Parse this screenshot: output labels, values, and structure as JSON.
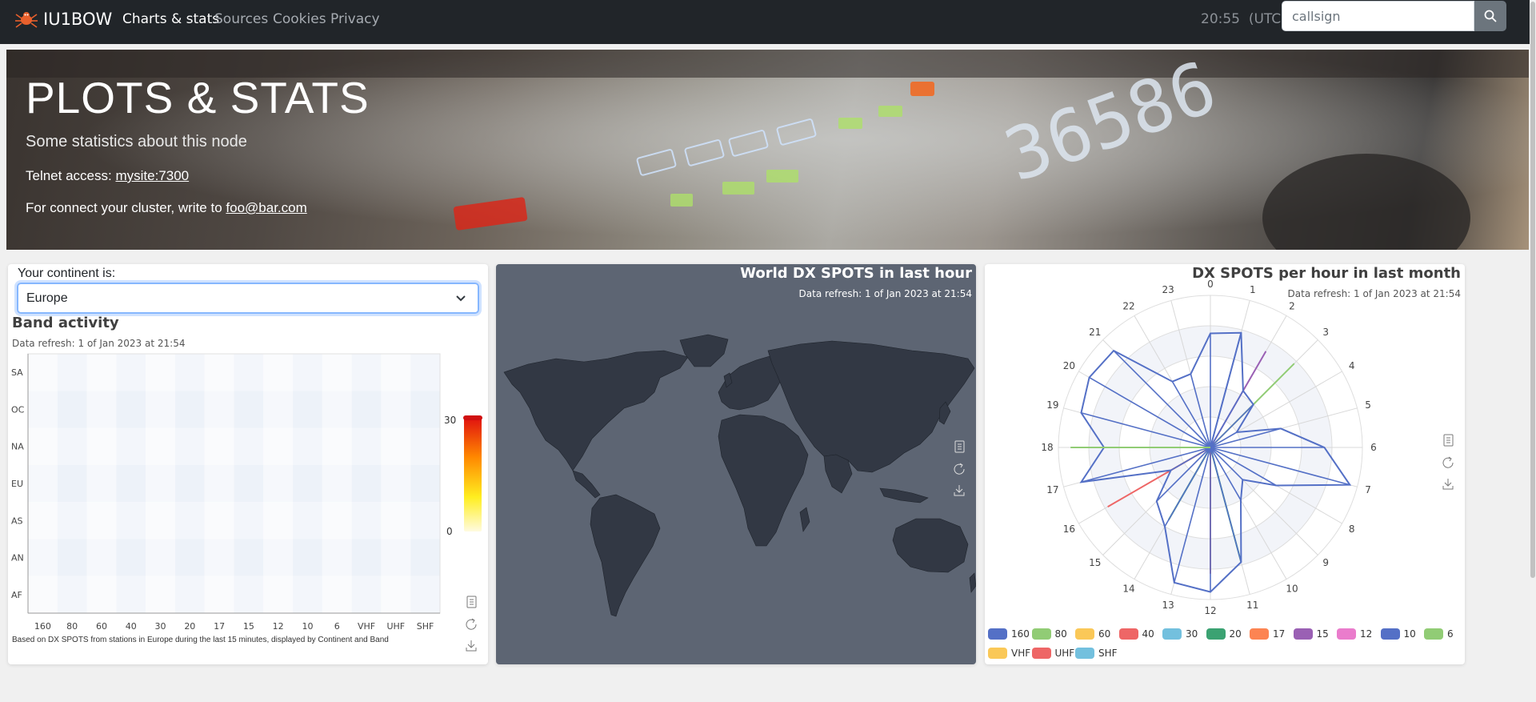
{
  "navbar": {
    "brand": "IU1BOW",
    "links": [
      "Charts & stats",
      "Sources",
      "Cookies",
      "Privacy"
    ],
    "clock": "20:55",
    "clock_tz": "(UTC)",
    "search_placeholder": "callsign"
  },
  "hero": {
    "title": "PLOTS & STATS",
    "subtitle": "Some statistics about this node",
    "telnet_label": "Telnet access:",
    "telnet_link": "mysite:7300",
    "connect_label": "For connect your cluster, write to",
    "connect_link": "foo@bar.com"
  },
  "band_activity": {
    "continent_label": "Your continent is:",
    "continent_value": "Europe",
    "title": "Band activity",
    "refresh": "Data refresh: 1 of Jan 2023 at 21:54",
    "footnote": "Based on DX SPOTS from stations in Europe during the last 15 minutes, displayed by Continent and Band",
    "scale_max": "30",
    "scale_min": "0"
  },
  "world_map": {
    "title": "World DX SPOTS in last hour",
    "refresh": "Data refresh: 1 of Jan 2023 at 21:54"
  },
  "polar": {
    "title": "DX SPOTS per hour in last month",
    "refresh": "Data refresh: 1 of Jan 2023 at 21:54"
  },
  "colors": {
    "navbar": "#212529",
    "map_bg": "#5d6573",
    "land": "#323844"
  },
  "chart_data": [
    {
      "type": "heatmap",
      "title": "Band activity",
      "x": [
        "160",
        "80",
        "60",
        "40",
        "30",
        "20",
        "17",
        "15",
        "12",
        "10",
        "6",
        "VHF",
        "UHF",
        "SHF"
      ],
      "y": [
        "SA",
        "OC",
        "NA",
        "EU",
        "AS",
        "AN",
        "AF"
      ],
      "values": [],
      "scale": [
        0,
        30
      ]
    },
    {
      "type": "line",
      "title": "DX SPOTS per hour in last month",
      "projection": "polar",
      "categories": [
        "0",
        "1",
        "2",
        "3",
        "4",
        "5",
        "6",
        "7",
        "8",
        "9",
        "10",
        "11",
        "12",
        "13",
        "14",
        "15",
        "16",
        "17",
        "18",
        "19",
        "20",
        "21",
        "22",
        "23"
      ],
      "series": [
        {
          "name": "160",
          "color": "#5470c6",
          "values": [
            0,
            0.78,
            0,
            0,
            0,
            0,
            0,
            0,
            0,
            0,
            0,
            0,
            0,
            0,
            0,
            0,
            0,
            0,
            0,
            0,
            0,
            0,
            0,
            0
          ]
        },
        {
          "name": "80",
          "color": "#91cc75",
          "values": [
            0,
            0,
            0,
            0.78,
            0,
            0,
            0,
            0,
            0,
            0,
            0,
            0,
            0,
            0,
            0,
            0,
            0,
            0,
            0,
            0,
            0,
            0,
            0,
            0
          ]
        },
        {
          "name": "60",
          "color": "#fac858",
          "values": [
            0,
            0,
            0,
            0,
            0,
            0,
            0,
            0,
            0,
            0,
            0,
            0,
            0,
            0,
            0,
            0,
            0,
            0,
            0,
            0,
            0,
            0,
            0,
            0
          ]
        },
        {
          "name": "40",
          "color": "#ee6666",
          "values": [
            0,
            0,
            0,
            0,
            0,
            0,
            0,
            0,
            0,
            0,
            0,
            0,
            0.83,
            0,
            0,
            0,
            0.78,
            0,
            0,
            0,
            0,
            0,
            0,
            0
          ]
        },
        {
          "name": "30",
          "color": "#73c0de",
          "values": [
            0,
            0,
            0,
            0,
            0,
            0,
            0,
            0,
            0,
            0,
            0,
            0,
            0,
            0,
            0,
            0,
            0,
            0,
            0,
            0,
            0,
            0,
            0,
            0
          ]
        },
        {
          "name": "20",
          "color": "#3ba272",
          "values": [
            0,
            0,
            0,
            0,
            0,
            0,
            0,
            0,
            0,
            0,
            0,
            0.78,
            0,
            0,
            0.55,
            0,
            0,
            0,
            0,
            0,
            0,
            0,
            0,
            0
          ]
        },
        {
          "name": "17",
          "color": "#fc8452",
          "values": [
            0,
            0,
            0,
            0,
            0,
            0,
            0,
            0,
            0,
            0,
            0,
            0,
            0,
            0,
            0,
            0,
            0,
            0,
            0,
            0,
            0,
            0,
            0,
            0
          ]
        },
        {
          "name": "15",
          "color": "#9a60b4",
          "values": [
            0,
            0,
            0.73,
            0,
            0,
            0,
            0,
            0,
            0,
            0,
            0,
            0,
            0,
            0,
            0,
            0,
            0,
            0,
            0,
            0,
            0,
            0,
            0,
            0
          ]
        },
        {
          "name": "12",
          "color": "#ea7ccc",
          "values": [
            0,
            0,
            0,
            0,
            0,
            0,
            0,
            0,
            0,
            0,
            0,
            0,
            0,
            0,
            0,
            0,
            0,
            0,
            0,
            0,
            0,
            0,
            0,
            0
          ]
        },
        {
          "name": "10",
          "color": "#5470c6",
          "values": [
            0.75,
            0.78,
            0.43,
            0.4,
            0.2,
            0.48,
            0.75,
            0.95,
            0.5,
            0.3,
            0.4,
            0.78,
            0.95,
            0.92,
            0.6,
            0.5,
            0.3,
            0.88,
            0.7,
            0.88,
            0.92,
            0.9,
            0.5,
            0.5
          ]
        },
        {
          "name": "6",
          "color": "#91cc75",
          "values": [
            0,
            0,
            0,
            0,
            0,
            0,
            0,
            0,
            0,
            0,
            0,
            0,
            0,
            0,
            0,
            0,
            0,
            0,
            0.92,
            0,
            0,
            0,
            0,
            0
          ]
        },
        {
          "name": "VHF",
          "color": "#fac858",
          "values": [
            0,
            0,
            0,
            0,
            0,
            0,
            0,
            0,
            0,
            0,
            0,
            0,
            0,
            0,
            0,
            0,
            0,
            0,
            0,
            0,
            0,
            0,
            0,
            0
          ]
        },
        {
          "name": "UHF",
          "color": "#ee6666",
          "values": [
            0,
            0,
            0,
            0,
            0,
            0,
            0,
            0,
            0,
            0,
            0,
            0,
            0,
            0,
            0,
            0,
            0,
            0,
            0,
            0,
            0,
            0,
            0,
            0
          ]
        },
        {
          "name": "SHF",
          "color": "#73c0de",
          "values": [
            0,
            0,
            0,
            0,
            0,
            0,
            0,
            0,
            0,
            0,
            0,
            0,
            0,
            0,
            0,
            0,
            0,
            0,
            0,
            0,
            0,
            0,
            0,
            0
          ]
        }
      ]
    }
  ]
}
